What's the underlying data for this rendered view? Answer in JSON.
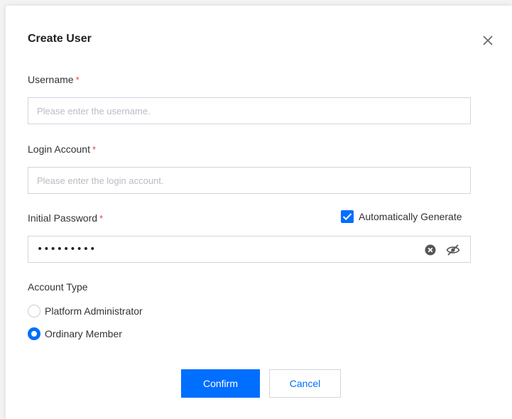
{
  "dialog": {
    "title": "Create User",
    "close_icon": "close-icon"
  },
  "form": {
    "username": {
      "label": "Username",
      "required_mark": "*",
      "placeholder": "Please enter the username.",
      "value": ""
    },
    "login_account": {
      "label": "Login Account",
      "required_mark": "*",
      "placeholder": "Please enter the login account.",
      "value": ""
    },
    "initial_password": {
      "label": "Initial Password",
      "required_mark": "*",
      "masked_value": "•••••••••",
      "auto_generate_label": "Automatically Generate",
      "auto_generate_checked": true,
      "icons": [
        "clear-icon",
        "eye-off-icon"
      ]
    },
    "account_type": {
      "label": "Account Type",
      "options": [
        {
          "label": "Platform Administrator",
          "selected": false
        },
        {
          "label": "Ordinary Member",
          "selected": true
        }
      ]
    }
  },
  "actions": {
    "confirm_label": "Confirm",
    "cancel_label": "Cancel"
  },
  "colors": {
    "accent": "#006eff",
    "required": "#e54545",
    "border": "#cfd5de"
  }
}
